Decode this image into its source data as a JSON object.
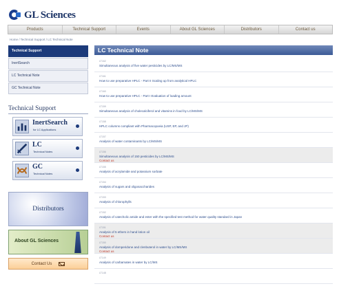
{
  "brand": {
    "name": "GL Sciences"
  },
  "topnav": [
    "Products",
    "Technical Support",
    "Events",
    "About GL Sciences",
    "Distributors",
    "Contact us"
  ],
  "breadcrumb": "Home / Technical Support / LC Technical Note",
  "sidebar": {
    "menu": [
      "Technical Support",
      "InertSearch",
      "LC Technical Note",
      "GC Technical Note"
    ],
    "support_heading": "Technical Support",
    "support_buttons": [
      {
        "title": "InertSearch",
        "subtitle": "for LC Applications"
      },
      {
        "title": "LC",
        "subtitle": "Technical Notes"
      },
      {
        "title": "GC",
        "subtitle": "Technical Notes"
      }
    ],
    "banners": {
      "distributors": "Distributors",
      "about": "About GL Sciences",
      "contact": "Contact Us"
    }
  },
  "main": {
    "title": "LC Technical Note",
    "notes": [
      {
        "code": "LT162",
        "title": "Simultaneous analysis of five water pesticides by LC/MS/MS",
        "contact": "",
        "shaded": false
      },
      {
        "code": "LT161",
        "title": "How to use preparative HPLC - Part II Scaling up from analytical HPLC",
        "contact": "",
        "shaded": false
      },
      {
        "code": "LT160",
        "title": "How to use preparative HPLC - Part I Evaluation of loading amount",
        "contact": "",
        "shaded": false
      },
      {
        "code": "LT159",
        "title": "Simultaneous analysis of cholecalciferol and vitamins in food by LC/MS/MS",
        "contact": "",
        "shaded": false
      },
      {
        "code": "LT158",
        "title": "HPLC columns compliant with Pharmacopoeia (USP, EP, and JP)",
        "contact": "",
        "shaded": false
      },
      {
        "code": "LT157",
        "title": "Analysis of water contaminants by LC/MS/MS",
        "contact": "",
        "shaded": false
      },
      {
        "code": "LT156",
        "title": "Simultaneous analysis of 150 pesticides by LC/MS/MS",
        "contact": "Contact us",
        "shaded": true
      },
      {
        "code": "LT155",
        "title": "Analysis of acrylamide and potassium sorbate",
        "contact": "",
        "shaded": false
      },
      {
        "code": "LT154",
        "title": "Analysis of sugars and oligosaccharides",
        "contact": "",
        "shaded": false
      },
      {
        "code": "LT153",
        "title": "Analysis of chlorophylls",
        "contact": "",
        "shaded": false
      },
      {
        "code": "LT152",
        "title": "Analysis of catecholic amide and ester with the specified test method for water quality standard in Japan",
        "contact": "",
        "shaded": false
      },
      {
        "code": "LT151",
        "title": "Analysis of 5 ethers in hand lotion oil",
        "contact": "Contact us",
        "shaded": true
      },
      {
        "code": "LT150",
        "title": "Analysis of domperidone and clenbuterol in water by LC/MS/MS",
        "contact": "Contact us",
        "shaded": true
      },
      {
        "code": "LT149",
        "title": "Analysis of carbamates in water by LC/MS",
        "contact": "",
        "shaded": false
      },
      {
        "code": "LT148",
        "title": "",
        "contact": "",
        "shaded": false
      }
    ]
  },
  "colors": {
    "nav_active": "#1c3a7a",
    "title_bar": "#4a669f",
    "link": "#2f4f8e",
    "contact": "#c0392b"
  }
}
